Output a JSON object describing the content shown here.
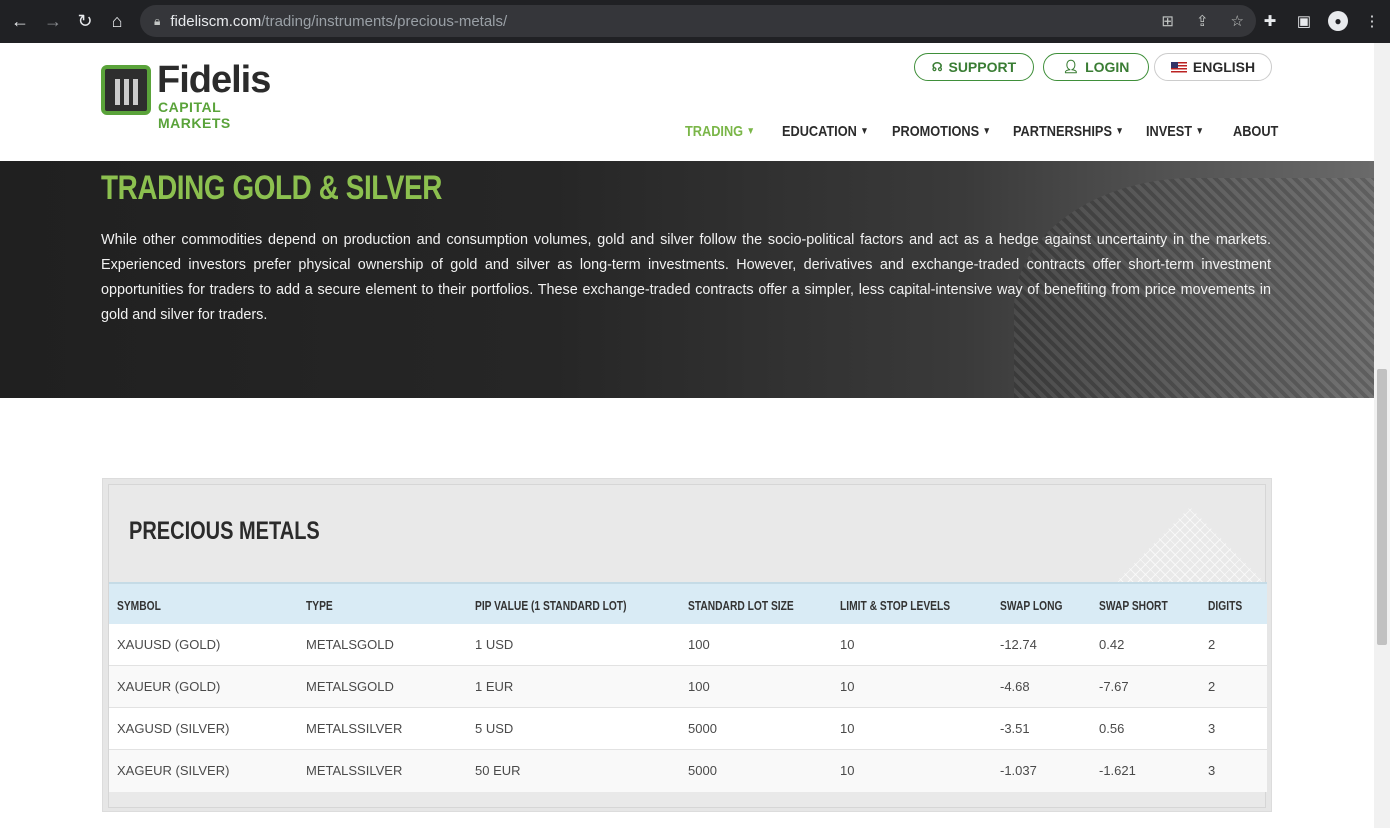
{
  "browser": {
    "url_domain": "fideliscm.com",
    "url_path": "/trading/instruments/precious-metals/"
  },
  "header": {
    "logo_name": "Fidelis",
    "logo_sub": "CAPITAL MARKETS",
    "support_label": "SUPPORT",
    "login_label": "LOGIN",
    "language_label": "ENGLISH",
    "nav": [
      {
        "label": "TRADING",
        "active": true
      },
      {
        "label": "EDUCATION"
      },
      {
        "label": "PROMOTIONS"
      },
      {
        "label": "PARTNERSHIPS"
      },
      {
        "label": "INVEST"
      },
      {
        "label": "ABOUT"
      }
    ]
  },
  "hero": {
    "title": "TRADING GOLD & SILVER",
    "text": "While other commodities depend on production and consumption volumes, gold and silver follow the socio-political factors and act as a hedge against uncertainty in the markets. Experienced investors prefer physical ownership of gold and silver as long-term investments. However, derivatives and exchange-traded contracts offer short-term investment opportunities for traders to add a secure element to their portfolios. These exchange-traded contracts offer a simpler, less capital-intensive way of benefiting from price movements in gold and silver for traders."
  },
  "table": {
    "title": "PRECIOUS METALS",
    "columns": [
      "SYMBOL",
      "TYPE",
      "PIP VALUE (1 STANDARD LOT)",
      "STANDARD LOT SIZE",
      "LIMIT & STOP LEVELS",
      "SWAP LONG",
      "SWAP SHORT",
      "DIGITS"
    ],
    "rows": [
      [
        "XAUUSD (GOLD)",
        "METALSGOLD",
        "1 USD",
        "100",
        "10",
        "-12.74",
        "0.42",
        "2"
      ],
      [
        "XAUEUR (GOLD)",
        "METALSGOLD",
        "1 EUR",
        "100",
        "10",
        "-4.68",
        "-7.67",
        "2"
      ],
      [
        "XAGUSD (SILVER)",
        "METALSSILVER",
        "5 USD",
        "5000",
        "10",
        "-3.51",
        "0.56",
        "3"
      ],
      [
        "XAGEUR (SILVER)",
        "METALSSILVER",
        "50 EUR",
        "5000",
        "10",
        "-1.037",
        "-1.621",
        "3"
      ]
    ]
  },
  "colors": {
    "brand_green": "#7ab648",
    "table_header": "#d9ebf5"
  }
}
